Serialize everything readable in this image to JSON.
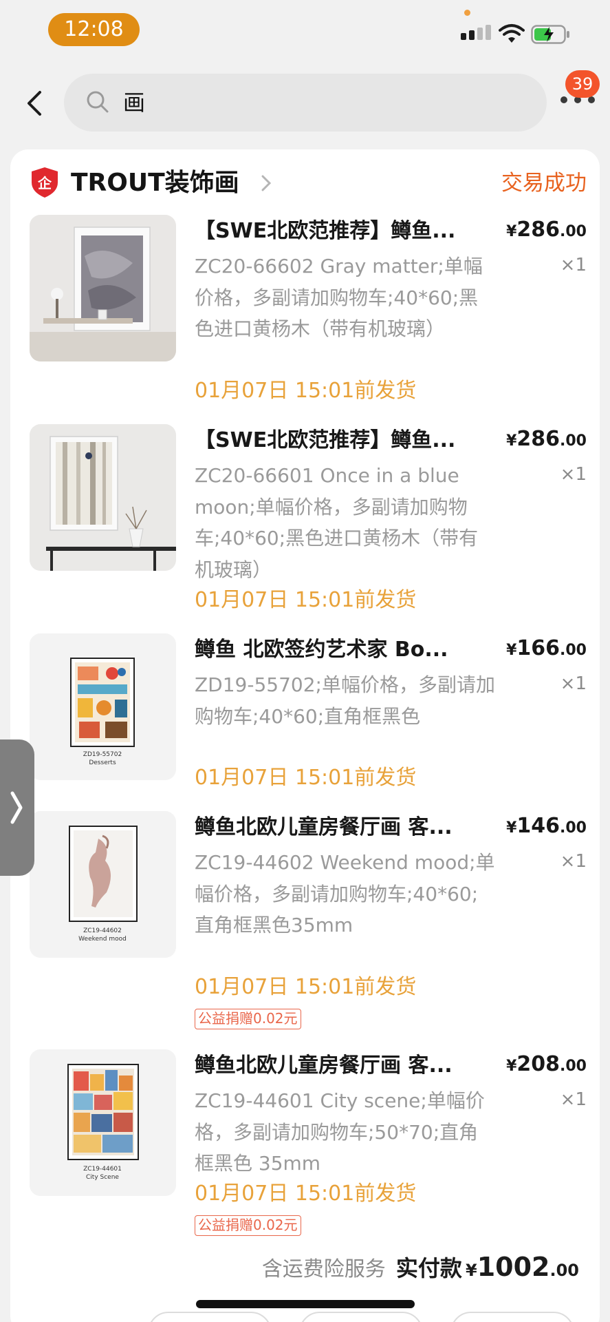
{
  "status_bar": {
    "time": "12:08"
  },
  "header": {
    "search_query": "画",
    "badge_count": "39"
  },
  "store": {
    "name": "TROUT装饰画",
    "logo_text": "企",
    "order_status": "交易成功"
  },
  "items": [
    {
      "title": "【SWE北欧范推荐】鳟鱼...",
      "price_currency": "¥",
      "price_int": "286",
      "price_dec": ".00",
      "qty": "×1",
      "desc": "ZC20-66602 Gray matter;单幅价格，多副请加购物车;40*60;黑色进口黄杨木（带有机玻璃）",
      "ship": "01月07日 15:01前发货"
    },
    {
      "title": "【SWE北欧范推荐】鳟鱼...",
      "price_currency": "¥",
      "price_int": "286",
      "price_dec": ".00",
      "qty": "×1",
      "desc": "ZC20-66601 Once in a blue moon;单幅价格，多副请加购物车;40*60;黑色进口黄杨木（带有机玻璃）",
      "ship": "01月07日 15:01前发货"
    },
    {
      "title": "鳟鱼 北欧签约艺术家 Bo...",
      "price_currency": "¥",
      "price_int": "166",
      "price_dec": ".00",
      "qty": "×1",
      "desc": "ZD19-55702;单幅价格，多副请加购物车;40*60;直角框黑色",
      "ship": "01月07日 15:01前发货",
      "thumb_caption_1": "ZD19-55702",
      "thumb_caption_2": "Desserts"
    },
    {
      "title": "鳟鱼北欧儿童房餐厅画 客...",
      "price_currency": "¥",
      "price_int": "146",
      "price_dec": ".00",
      "qty": "×1",
      "desc": "ZC19-44602 Weekend mood;单幅价格，多副请加购物车;40*60;直角框黑色35mm",
      "ship": "01月07日 15:01前发货",
      "donation": "公益捐赠0.02元",
      "thumb_caption_1": "ZC19-44602",
      "thumb_caption_2": "Weekend mood"
    },
    {
      "title": "鳟鱼北欧儿童房餐厅画 客...",
      "price_currency": "¥",
      "price_int": "208",
      "price_dec": ".00",
      "qty": "×1",
      "desc": "ZC19-44601 City scene;单幅价格，多副请加购物车;50*70;直角框黑色 35mm",
      "ship": "01月07日 15:01前发货",
      "donation": "公益捐赠0.02元",
      "thumb_caption_1": "ZC19-44601",
      "thumb_caption_2": "City Scene"
    }
  ],
  "total": {
    "note": "含运费险服务",
    "label": "实付款",
    "currency": "¥",
    "int": "1002",
    "dec": ".00"
  },
  "colors": {
    "accent_orange": "#e8621f",
    "ship_orange": "#e8a23a",
    "time_pill": "#e08d14",
    "badge_red": "#f3542b"
  },
  "icons": [
    "back-arrow-icon",
    "search-icon",
    "more-dots-icon",
    "store-shield-icon",
    "chevron-right-icon",
    "side-expand-icon"
  ]
}
